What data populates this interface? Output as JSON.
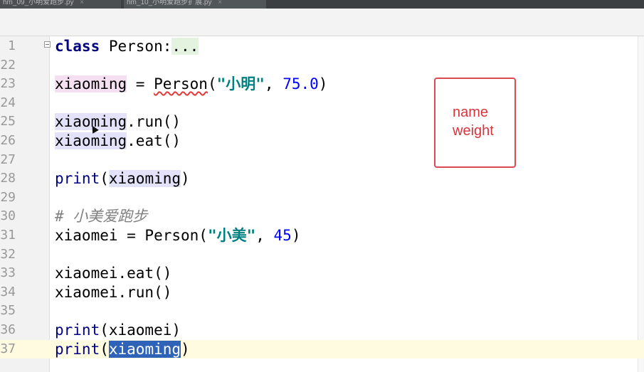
{
  "tabs": [
    {
      "label": "hm_09_小明爱跑步.py",
      "close": "×"
    },
    {
      "label": "hm_10_小明爱跑步扩展.py",
      "close": "×"
    }
  ],
  "editor": {
    "lines": [
      {
        "n": "1",
        "tokens": [
          {
            "t": "class",
            "c": "kw"
          },
          {
            "t": " Person:"
          },
          {
            "t": "...",
            "c": "fold-dots"
          }
        ]
      },
      {
        "n": "22",
        "tokens": []
      },
      {
        "n": "23",
        "tokens": [
          {
            "t": "xiaoming",
            "c": "hl-write"
          },
          {
            "t": " = "
          },
          {
            "t": "Person",
            "c": "wavy"
          },
          {
            "t": "("
          },
          {
            "t": "\"小明\"",
            "c": "str"
          },
          {
            "t": ", "
          },
          {
            "t": "75.0",
            "c": "num"
          },
          {
            "t": ")"
          }
        ]
      },
      {
        "n": "24",
        "tokens": []
      },
      {
        "n": "25",
        "tokens": [
          {
            "t": "xiaoming",
            "c": "hl-read"
          },
          {
            "t": ".run()"
          }
        ]
      },
      {
        "n": "26",
        "tokens": [
          {
            "t": "xiaoming",
            "c": "hl-read"
          },
          {
            "t": ".eat()"
          }
        ]
      },
      {
        "n": "27",
        "tokens": []
      },
      {
        "n": "28",
        "tokens": [
          {
            "t": "print",
            "c": "builtin"
          },
          {
            "t": "("
          },
          {
            "t": "xiaoming",
            "c": "hl-read"
          },
          {
            "t": ")"
          }
        ]
      },
      {
        "n": "29",
        "tokens": []
      },
      {
        "n": "30",
        "tokens": [
          {
            "t": "# 小美爱跑步",
            "c": "comment"
          }
        ]
      },
      {
        "n": "31",
        "tokens": [
          {
            "t": "xiaomei = Person("
          },
          {
            "t": "\"小美\"",
            "c": "str"
          },
          {
            "t": ", "
          },
          {
            "t": "45",
            "c": "num"
          },
          {
            "t": ")"
          }
        ]
      },
      {
        "n": "32",
        "tokens": []
      },
      {
        "n": "33",
        "tokens": [
          {
            "t": "xiaomei.eat()"
          }
        ]
      },
      {
        "n": "34",
        "tokens": [
          {
            "t": "xiaomei.run()"
          }
        ]
      },
      {
        "n": "35",
        "tokens": []
      },
      {
        "n": "36",
        "tokens": [
          {
            "t": "print",
            "c": "builtin"
          },
          {
            "t": "(xiaomei)"
          }
        ]
      },
      {
        "n": "37",
        "tokens": [
          {
            "t": "print",
            "c": "builtin"
          },
          {
            "t": "("
          },
          {
            "t": "xiaoming",
            "c": "hl-sel"
          },
          {
            "t": ")"
          }
        ],
        "current": true
      }
    ]
  },
  "annotation": {
    "line1": "name",
    "line2": "weight",
    "border_color": "#d94a52"
  },
  "icons": {
    "fold": "fold-toggle-icon",
    "cursor": "mouse-pointer-icon"
  }
}
